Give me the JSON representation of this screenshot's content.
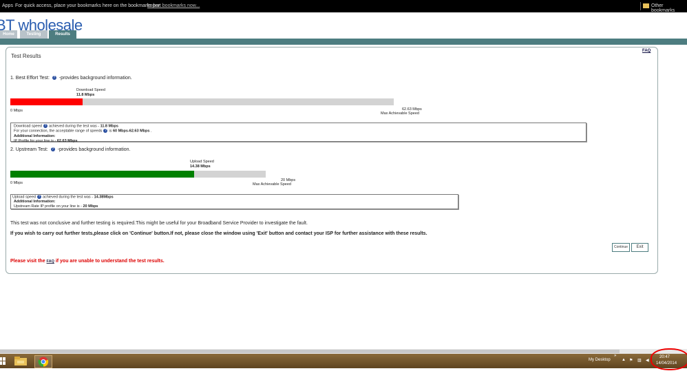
{
  "bookmarks_bar": {
    "apps": "Apps",
    "hint": "For quick access, place your bookmarks here on the bookmarks bar.",
    "import_link": "Import bookmarks now...",
    "other": "Other bookmarks"
  },
  "header": {
    "logo": "BT wholesale",
    "tabs": [
      {
        "label": "Home"
      },
      {
        "label": "Testing"
      },
      {
        "label": "Results"
      }
    ]
  },
  "page": {
    "title": "Test Results",
    "faq_link": "FAQ",
    "best_effort": {
      "heading": "1. Best Effort Test:",
      "info": "-provides background information.",
      "caption": "Download Speed",
      "speed": "11.8 Mbps",
      "min_label": "0 Mbps",
      "max_value": "62.63 Mbps",
      "max_label": "Max Achievable Speed",
      "fill_fraction": 0.188,
      "bar_color": "#ff0000",
      "box": {
        "l1a": "Download speed",
        "l1b": "achieved during the test was -",
        "l1c": "11.8 Mbps",
        "l2a": "For your connection, the acceptable range of speeds",
        "l2b": "is",
        "l2c": "60 Mbps-62.63 Mbps",
        "l2d": ".",
        "l3": "Additional Information:",
        "l4a": "IP Profile for your line is -",
        "l4b": "62.63 Mbps"
      }
    },
    "upstream": {
      "heading": "2. Upstream Test:",
      "info": "-provides background information.",
      "caption": "Upload Speed",
      "speed": "14.38 Mbps",
      "min_label": "0 Mbps",
      "max_value": "20 Mbps",
      "max_label": "Max Achievable Speed",
      "fill_fraction": 0.719,
      "bar_color": "#008000",
      "box": {
        "l1a": "Upload speed",
        "l1b": "achieved during the test was -",
        "l1c": "14.38Mbps",
        "l2": "Additional Information:",
        "l3a": "Upstream Rate IP profile on your line is -",
        "l3b": "20 Mbps"
      }
    },
    "note": "This test was not conclusive and further testing is required.This might be useful for your Broadband Service Provider to investigate the fault.",
    "instruction": "If you wish to carry out further tests,please click on 'Continue' button.If not, please close the window using 'Exit' button and contact your ISP for further assistance with these results.",
    "continue_button": "Continue",
    "exit_button": "Exit",
    "faq_notice_a": "Please visit the",
    "faq_notice_link": "FAQ",
    "faq_notice_b": "if you are unable to understand the test results."
  },
  "taskbar": {
    "desktop_label": "My Desktop",
    "chevron": "»",
    "time": "20:47",
    "date": "14/04/2014"
  }
}
